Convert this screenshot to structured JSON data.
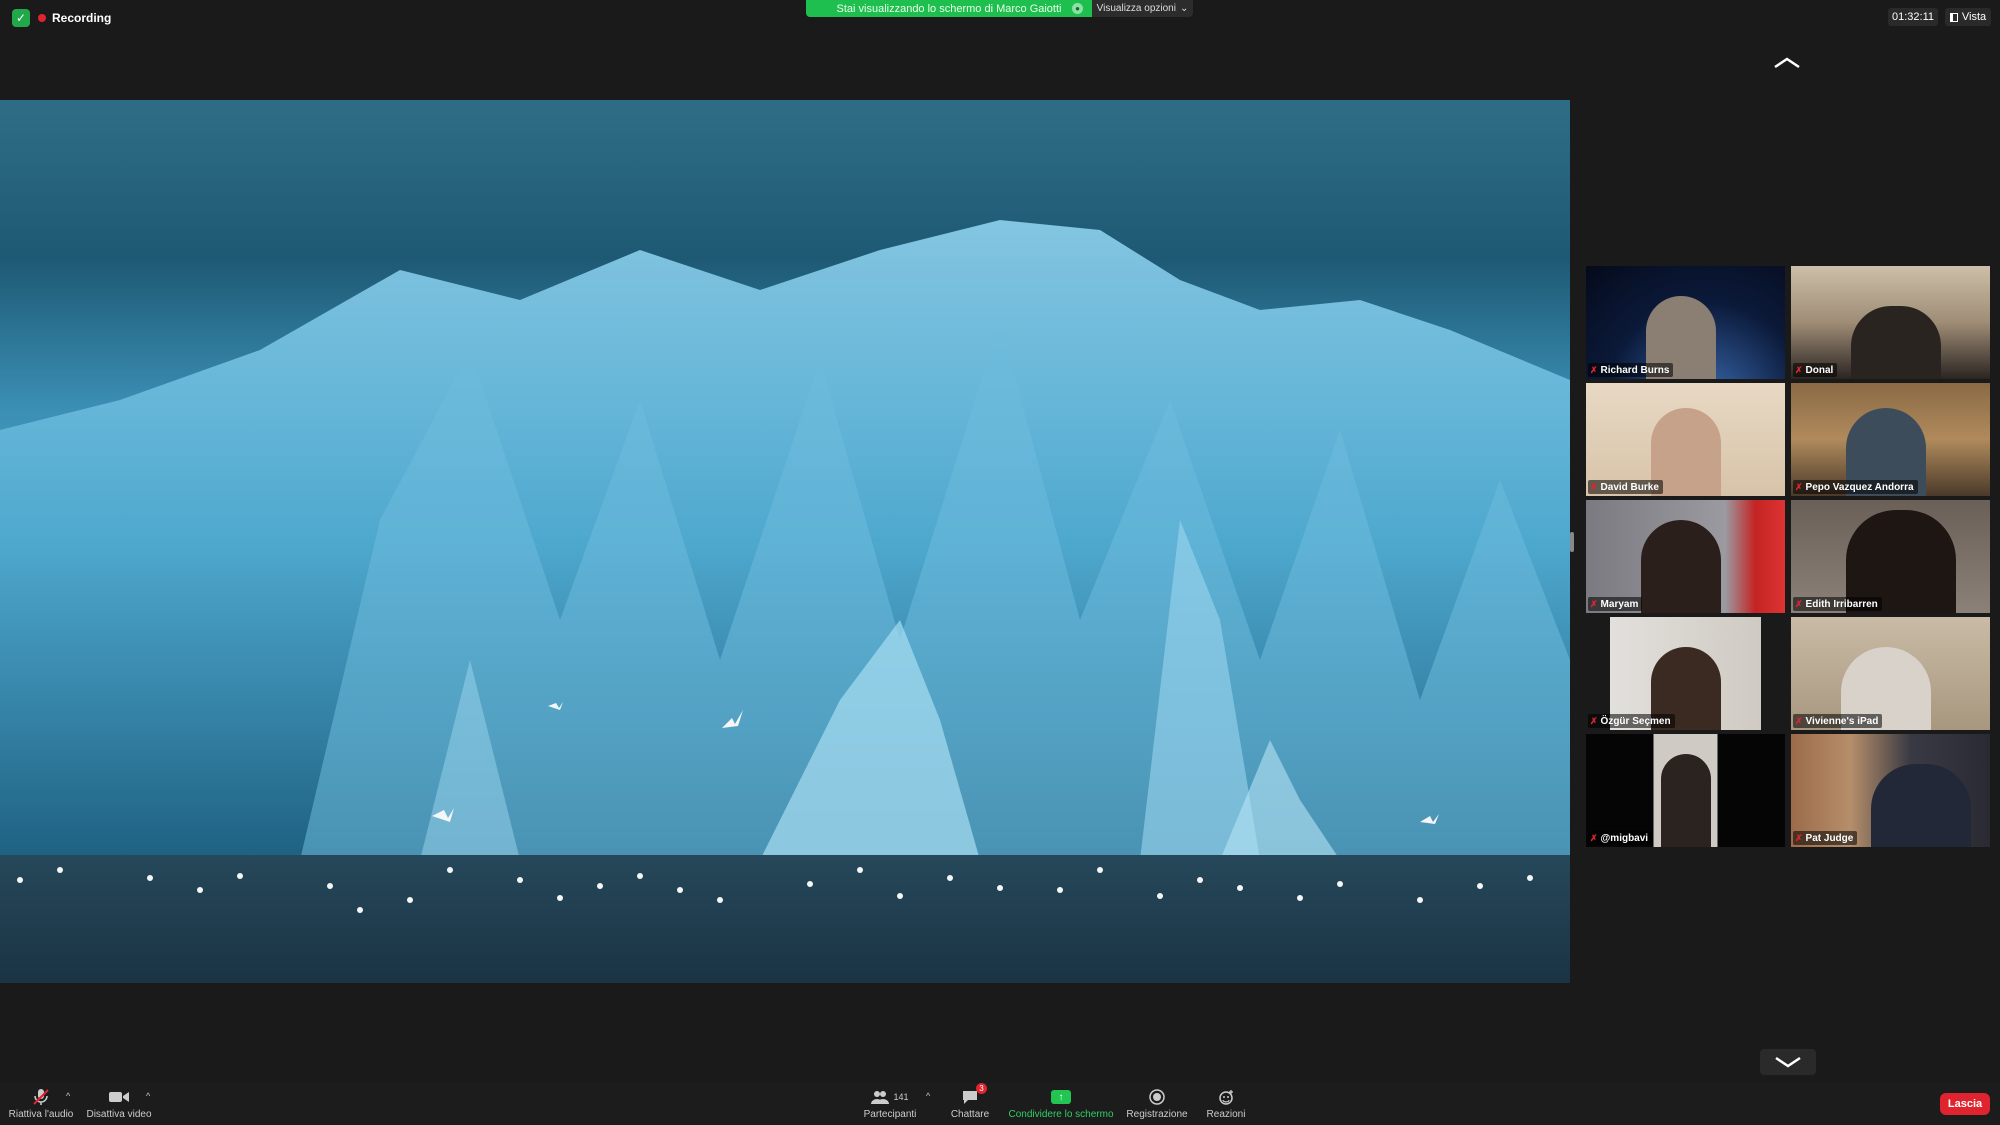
{
  "topbar": {
    "recording": "Recording",
    "share_banner": "Stai visualizzando lo schermo di Marco Gaiotti",
    "view_options": "Visualizza opzioni",
    "timer": "01:32:11",
    "view": "Vista"
  },
  "participants": [
    {
      "name": "Richard Burns"
    },
    {
      "name": "Donal"
    },
    {
      "name": "David Burke"
    },
    {
      "name": "Pepo Vazquez Andorra"
    },
    {
      "name": "Maryam"
    },
    {
      "name": "Edith Irribarren"
    },
    {
      "name": "Özgür Seçmen"
    },
    {
      "name": "Vivienne's iPad"
    },
    {
      "name": "@migbavi"
    },
    {
      "name": "Pat Judge"
    }
  ],
  "toolbar": {
    "audio": "Riattiva l'audio",
    "video": "Disattiva video",
    "participants": "Partecipanti",
    "participants_count": "141",
    "chat": "Chattare",
    "chat_badge": "3",
    "share": "Condividere lo schermo",
    "record": "Registrazione",
    "reactions": "Reazioni",
    "leave": "Lascia"
  },
  "colors": {
    "share_banner": "#1fbf4f",
    "leave": "#e0242f",
    "recording_dot": "#e0242f",
    "share_icon": "#23c552"
  },
  "icons": [
    "shield-icon",
    "chevron-up-icon",
    "chevron-down-icon",
    "mic-off-icon",
    "camera-icon",
    "participants-icon",
    "chat-icon",
    "share-screen-icon",
    "record-icon",
    "reactions-icon"
  ]
}
